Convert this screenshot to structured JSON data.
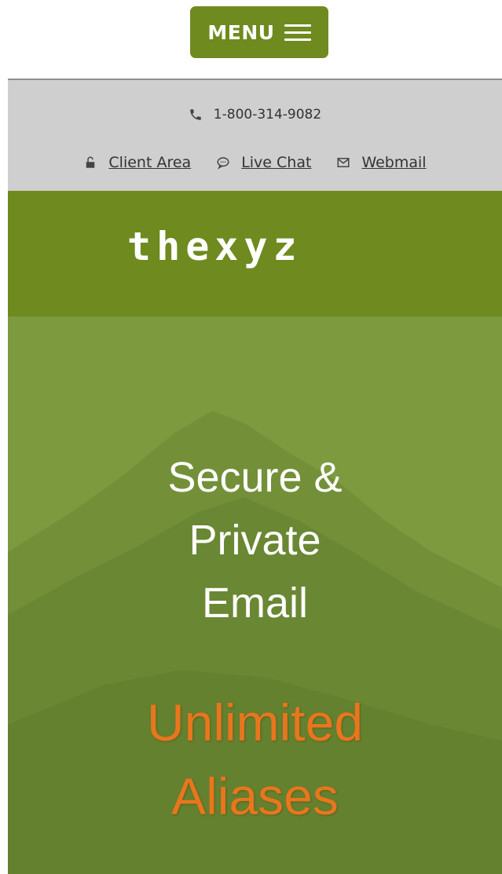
{
  "header": {
    "menu_label": "MENU"
  },
  "info_bar": {
    "phone": "1-800-314-9082",
    "links": [
      {
        "label": "Client Area",
        "icon": "lock-icon"
      },
      {
        "label": "Live Chat",
        "icon": "chat-bubble-icon"
      },
      {
        "label": "Webmail",
        "icon": "envelope-icon"
      }
    ]
  },
  "logo": {
    "text": "thexyz"
  },
  "hero": {
    "title_lines": [
      "Secure &",
      "Private",
      "Email"
    ],
    "subtitle_lines": [
      "Unlimited",
      "Aliases"
    ]
  },
  "colors": {
    "brand_green": "#6f8a1f",
    "hero_green": "#7d9a3e",
    "accent_orange": "#e8761d",
    "info_bar_gray": "#cfcfcf"
  }
}
